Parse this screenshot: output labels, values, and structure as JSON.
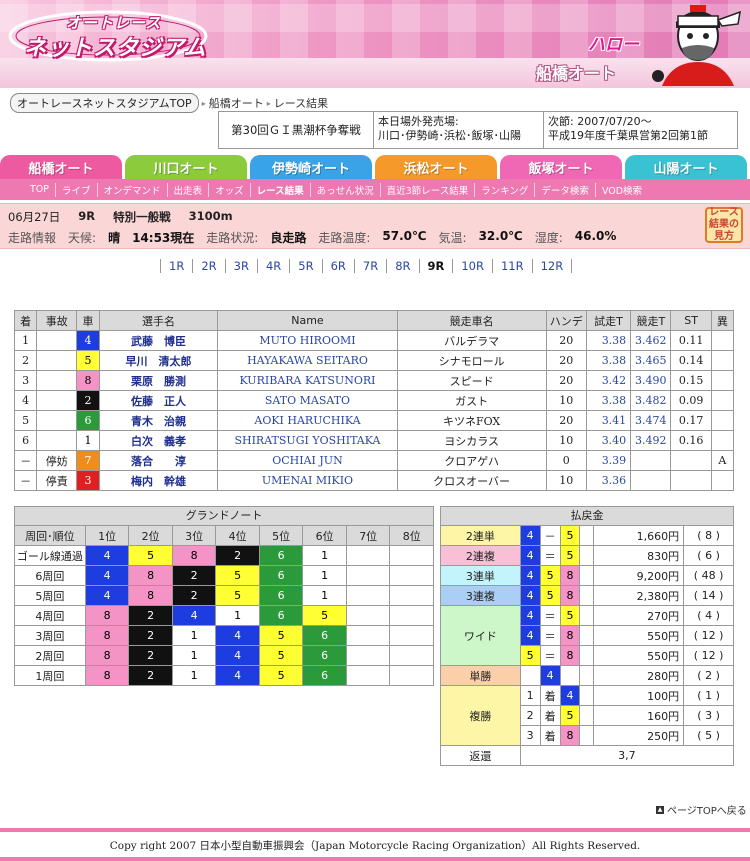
{
  "header": {
    "logo_line1": "オートレース",
    "logo_line2": "ネットスタジアム",
    "hello": "ハロー",
    "venue_title": "船橋オート"
  },
  "breadcrumb": {
    "top": "オートレースネットスタジアムTOP",
    "venue": "船橋オート",
    "page": "レース結果"
  },
  "info": {
    "title": "第30回ＧＩ黒潮杯争奪戦",
    "venues_label": "本日場外発売場:",
    "venues": "川口･伊勢崎･浜松･飯塚･山陽",
    "next_label": "次節: 2007/07/20〜",
    "next": "平成19年度千葉県営第2回第1節"
  },
  "tabs": [
    {
      "label": "船橋オート",
      "color": "#ee5aa0"
    },
    {
      "label": "川口オート",
      "color": "#8ccc3c"
    },
    {
      "label": "伊勢崎オート",
      "color": "#3aa3e8"
    },
    {
      "label": "浜松オート",
      "color": "#f59a2a"
    },
    {
      "label": "飯塚オート",
      "color": "#f068b4"
    },
    {
      "label": "山陽オート",
      "color": "#39c1d4"
    }
  ],
  "subnav": [
    "TOP",
    "ライブ",
    "オンデマンド",
    "出走表",
    "オッズ",
    "レース結果",
    "あっせん状況",
    "直近3節レース結果",
    "ランキング",
    "データ検索",
    "VOD検索"
  ],
  "race": {
    "date": "06月27日",
    "race_no": "9R",
    "race_name": "特別一般戦",
    "distance": "3100m",
    "label_info": "走路情報",
    "label_weather": "天候:",
    "weather": "晴",
    "time": "14:53現在",
    "label_track": "走路状況:",
    "track": "良走路",
    "label_track_temp": "走路温度:",
    "track_temp": "57.0℃",
    "label_air": "気温:",
    "air_temp": "32.0℃",
    "label_humidity": "湿度:",
    "humidity": "46.0%"
  },
  "guide_button": "レース結果の見方",
  "race_nav": [
    "1R",
    "2R",
    "3R",
    "4R",
    "5R",
    "6R",
    "7R",
    "8R",
    "9R",
    "10R",
    "11R",
    "12R"
  ],
  "results": {
    "headers": [
      "着",
      "事故",
      "車",
      "選手名",
      "Name",
      "競走車名",
      "ハンデ",
      "試走T",
      "競走T",
      "ST",
      "異"
    ],
    "rows": [
      {
        "place": "1",
        "accident": "",
        "car": "4",
        "name": "武藤　博臣",
        "en": "MUTO HIROOMI",
        "bike": "バルデラマ",
        "handi": "20",
        "trial": "3.38",
        "race": "3.462",
        "st": "0.11",
        "abn": ""
      },
      {
        "place": "2",
        "accident": "",
        "car": "5",
        "name": "早川　清太郎",
        "en": "HAYAKAWA SEITARO",
        "bike": "シナモロール",
        "handi": "20",
        "trial": "3.38",
        "race": "3.465",
        "st": "0.14",
        "abn": ""
      },
      {
        "place": "3",
        "accident": "",
        "car": "8",
        "name": "栗原　勝測",
        "en": "KURIBARA KATSUNORI",
        "bike": "スピード",
        "handi": "20",
        "trial": "3.42",
        "race": "3.490",
        "st": "0.15",
        "abn": ""
      },
      {
        "place": "4",
        "accident": "",
        "car": "2",
        "name": "佐藤　正人",
        "en": "SATO MASATO",
        "bike": "ガスト",
        "handi": "10",
        "trial": "3.38",
        "race": "3.482",
        "st": "0.09",
        "abn": ""
      },
      {
        "place": "5",
        "accident": "",
        "car": "6",
        "name": "青木　治親",
        "en": "AOKI HARUCHIKA",
        "bike": "キツネFOX",
        "handi": "20",
        "trial": "3.41",
        "race": "3.474",
        "st": "0.17",
        "abn": ""
      },
      {
        "place": "6",
        "accident": "",
        "car": "1",
        "name": "白次　義孝",
        "en": "SHIRATSUGI YOSHITAKA",
        "bike": "ヨシカラス",
        "handi": "10",
        "trial": "3.40",
        "race": "3.492",
        "st": "0.16",
        "abn": ""
      },
      {
        "place": "－",
        "accident": "停妨",
        "car": "7",
        "name": "落合　　淳",
        "en": "OCHIAI JUN",
        "bike": "クロアゲハ",
        "handi": "0",
        "trial": "3.39",
        "race": "",
        "st": "",
        "abn": "A"
      },
      {
        "place": "－",
        "accident": "停責",
        "car": "3",
        "name": "梅内　幹雄",
        "en": "UMENAI MIKIO",
        "bike": "クロスオーバー",
        "handi": "10",
        "trial": "3.36",
        "race": "",
        "st": "",
        "abn": ""
      }
    ]
  },
  "grand_note": {
    "title": "グランドノート",
    "headers": [
      "周回･順位",
      "1位",
      "2位",
      "3位",
      "4位",
      "5位",
      "6位",
      "7位",
      "8位"
    ],
    "rows": [
      {
        "label": "ゴール線通過",
        "cars": [
          "4",
          "5",
          "8",
          "2",
          "6",
          "1",
          "",
          ""
        ]
      },
      {
        "label": "6周回",
        "cars": [
          "4",
          "8",
          "2",
          "5",
          "6",
          "1",
          "",
          ""
        ]
      },
      {
        "label": "5周回",
        "cars": [
          "4",
          "8",
          "2",
          "5",
          "6",
          "1",
          "",
          ""
        ]
      },
      {
        "label": "4周回",
        "cars": [
          "8",
          "2",
          "4",
          "1",
          "6",
          "5",
          "",
          ""
        ]
      },
      {
        "label": "3周回",
        "cars": [
          "8",
          "2",
          "1",
          "4",
          "5",
          "6",
          "",
          ""
        ]
      },
      {
        "label": "2周回",
        "cars": [
          "8",
          "2",
          "1",
          "4",
          "5",
          "6",
          "",
          ""
        ]
      },
      {
        "label": "1周回",
        "cars": [
          "8",
          "2",
          "1",
          "4",
          "5",
          "6",
          "",
          ""
        ]
      }
    ]
  },
  "payout": {
    "title": "払戻金",
    "exacta": {
      "label": "2連単",
      "a": "4",
      "sym": "－",
      "b": "5",
      "amount": "1,660円",
      "pop": "( 8 )"
    },
    "quinella": {
      "label": "2連複",
      "a": "4",
      "sym": "＝",
      "b": "5",
      "amount": "830円",
      "pop": "( 6 )"
    },
    "trifecta": {
      "label": "3連単",
      "a": "4",
      "b": "5",
      "c": "8",
      "amount": "9,200円",
      "pop": "( 48 )"
    },
    "trio": {
      "label": "3連複",
      "a": "4",
      "b": "5",
      "c": "8",
      "amount": "2,380円",
      "pop": "( 14 )"
    },
    "wide": {
      "label": "ワイド",
      "sym": "＝",
      "rows": [
        {
          "a": "4",
          "b": "5",
          "amount": "270円",
          "pop": "( 4 )"
        },
        {
          "a": "4",
          "b": "8",
          "amount": "550円",
          "pop": "( 12 )"
        },
        {
          "a": "5",
          "b": "8",
          "amount": "550円",
          "pop": "( 12 )"
        }
      ]
    },
    "win": {
      "label": "単勝",
      "car": "4",
      "amount": "280円",
      "pop": "( 2 )"
    },
    "place": {
      "label": "複勝",
      "chaku": "着",
      "rows": [
        {
          "rank": "1",
          "car": "4",
          "amount": "100円",
          "pop": "( 1 )"
        },
        {
          "rank": "2",
          "car": "5",
          "amount": "160円",
          "pop": "( 3 )"
        },
        {
          "rank": "3",
          "car": "8",
          "amount": "250円",
          "pop": "( 5 )"
        }
      ]
    },
    "refund": {
      "label": "返還",
      "value": "3,7"
    }
  },
  "to_top": "ページTOPへ戻る",
  "footer": "Copy right 2007 日本小型自動車振興会（Japan Motorcycle Racing Organization）All Rights Reserved.",
  "car_colors": {
    "1": "#ffffff",
    "2": "#111111",
    "3": "#e02020",
    "4": "#1d3de0",
    "5": "#ffff33",
    "6": "#2b9a3a",
    "7": "#f08c1c",
    "8": "#f493c6"
  }
}
